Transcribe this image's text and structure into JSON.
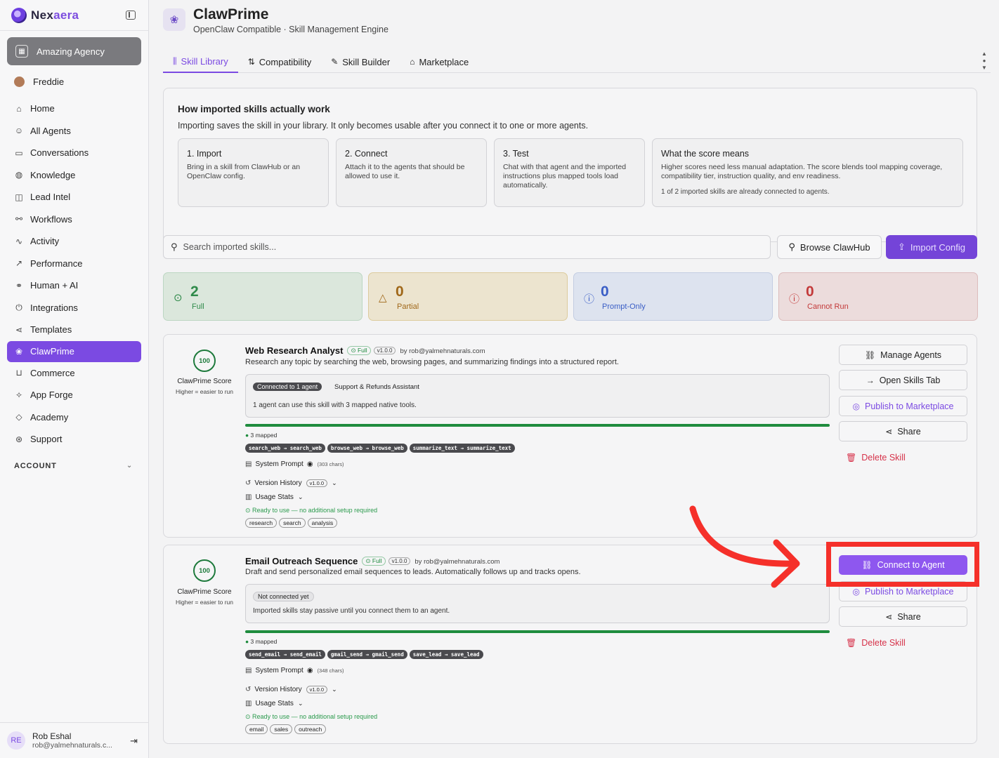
{
  "brand": {
    "name_pre": "Nex",
    "name_acc": "aera",
    "name_full": "Nexaera"
  },
  "sidebar": {
    "agency": "Amazing Agency",
    "user": "Freddie",
    "items": [
      {
        "label": "Home",
        "icon": "home-icon",
        "glyph": "⌂"
      },
      {
        "label": "All Agents",
        "icon": "agents-icon",
        "glyph": "☺"
      },
      {
        "label": "Conversations",
        "icon": "chat-icon",
        "glyph": "▭"
      },
      {
        "label": "Knowledge",
        "icon": "knowledge-icon",
        "glyph": "◍"
      },
      {
        "label": "Lead Intel",
        "icon": "lead-icon",
        "glyph": "◫"
      },
      {
        "label": "Workflows",
        "icon": "workflow-icon",
        "glyph": "⚯"
      },
      {
        "label": "Activity",
        "icon": "activity-icon",
        "glyph": "∿"
      },
      {
        "label": "Performance",
        "icon": "trend-icon",
        "glyph": "↗"
      },
      {
        "label": "Human + AI",
        "icon": "network-icon",
        "glyph": "⚭"
      },
      {
        "label": "Integrations",
        "icon": "plug-icon",
        "glyph": "⏻"
      },
      {
        "label": "Templates",
        "icon": "share-icon",
        "glyph": "⋖"
      },
      {
        "label": "ClawPrime",
        "icon": "clawprime-icon",
        "glyph": "❀"
      },
      {
        "label": "Commerce",
        "icon": "cart-icon",
        "glyph": "⊔"
      },
      {
        "label": "App Forge",
        "icon": "sparkle-icon",
        "glyph": "✧"
      },
      {
        "label": "Academy",
        "icon": "graduation-icon",
        "glyph": "◇"
      },
      {
        "label": "Support",
        "icon": "support-icon",
        "glyph": "⊛"
      }
    ],
    "account_label": "ACCOUNT",
    "footer": {
      "initials": "RE",
      "name": "Rob Eshal",
      "email": "rob@yalmehnaturals.c..."
    }
  },
  "header": {
    "title": "ClawPrime",
    "subtitle": "OpenClaw Compatible · Skill Management Engine"
  },
  "tabs": [
    {
      "label": "Skill Library",
      "glyph": "⫼"
    },
    {
      "label": "Compatibility",
      "glyph": "⇅"
    },
    {
      "label": "Skill Builder",
      "glyph": "✎"
    },
    {
      "label": "Marketplace",
      "glyph": "⌂"
    }
  ],
  "how": {
    "title": "How imported skills actually work",
    "subtitle": "Importing saves the skill in your library. It only becomes usable after you connect it to one or more agents.",
    "steps": [
      {
        "title": "1. Import",
        "desc": "Bring in a skill from ClawHub or an OpenClaw config."
      },
      {
        "title": "2. Connect",
        "desc": "Attach it to the agents that should be allowed to use it."
      },
      {
        "title": "3. Test",
        "desc": "Chat with that agent and the imported instructions plus mapped tools load automatically."
      },
      {
        "title": "What the score means",
        "desc": "Higher scores need less manual adaptation. The score blends tool mapping coverage, compatibility tier, instruction quality, and env readiness.",
        "note": "1 of 2 imported skills are already connected to agents."
      }
    ]
  },
  "search": {
    "placeholder": "Search imported skills..."
  },
  "buttons": {
    "browse": "Browse ClawHub",
    "import": "Import Config"
  },
  "stats": [
    {
      "value": "2",
      "label": "Full",
      "color": "#2f8a4a"
    },
    {
      "value": "0",
      "label": "Partial",
      "color": "#a0681a"
    },
    {
      "value": "0",
      "label": "Prompt-Only",
      "color": "#3a5ec6"
    },
    {
      "value": "0",
      "label": "Cannot Run",
      "color": "#c33a3a"
    }
  ],
  "skills": [
    {
      "score": "100",
      "score_label": "ClawPrime Score",
      "score_hint": "Higher = easier to run",
      "name": "Web Research Analyst",
      "tier": "Full",
      "version": "v1.0.0",
      "by": "by rob@yalmehnaturals.com",
      "desc": "Research any topic by searching the web, browsing pages, and summarizing findings into a structured report.",
      "conn_tag": "Connected to 1 agent",
      "conn_agent": "Support & Refunds Assistant",
      "conn_text": "1 agent can use this skill with 3 mapped native tools.",
      "mapped": "3 mapped",
      "tools": [
        "search_web → search_web",
        "browse_web → browse_web",
        "summarize_text → summarize_text"
      ],
      "system_prompt": "System Prompt",
      "chars": "(303 chars)",
      "version_history": "Version History",
      "usage_stats": "Usage Stats",
      "ready": "Ready to use — no additional setup required",
      "tags": [
        "research",
        "search",
        "analysis"
      ],
      "actions": [
        "Manage Agents",
        "Open Skills Tab",
        "Publish to Marketplace",
        "Share",
        "Delete Skill"
      ]
    },
    {
      "score": "100",
      "score_label": "ClawPrime Score",
      "score_hint": "Higher = easier to run",
      "name": "Email Outreach Sequence",
      "tier": "Full",
      "version": "v1.0.0",
      "by": "by rob@yalmehnaturals.com",
      "desc": "Draft and send personalized email sequences to leads. Automatically follows up and tracks opens.",
      "conn_tag": "Not connected yet",
      "conn_text": "Imported skills stay passive until you connect them to an agent.",
      "mapped": "3 mapped",
      "tools": [
        "send_email → send_email",
        "gmail_send → gmail_send",
        "save_lead → save_lead"
      ],
      "system_prompt": "System Prompt",
      "chars": "(348 chars)",
      "version_history": "Version History",
      "usage_stats": "Usage Stats",
      "ready": "Ready to use — no additional setup required",
      "tags": [
        "email",
        "sales",
        "outreach"
      ],
      "actions": [
        "Connect to Agent",
        "Publish to Marketplace",
        "Share",
        "Delete Skill"
      ]
    }
  ],
  "colors": {
    "accent": "#7b4ae2",
    "success": "#1f8c3e",
    "danger": "#d6324a",
    "highlight": "#f5302a"
  }
}
